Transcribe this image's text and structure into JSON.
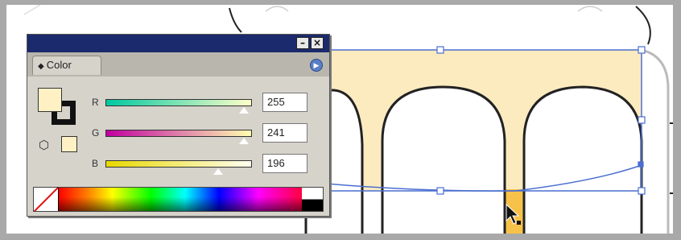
{
  "panel": {
    "tab_label": "Color",
    "titlebar_buttons": {
      "minimize_glyph": "–",
      "close_glyph": "×"
    },
    "menu_icon": "panel-menu-arrow-icon",
    "fill_color": "#FFF1C4",
    "stroke_color": "#000000",
    "sliders": [
      {
        "key": "r",
        "label": "R",
        "value": "255",
        "gradient_from": "#00c8a0",
        "gradient_to": "#ffffc8",
        "level": 1.0
      },
      {
        "key": "g",
        "label": "G",
        "value": "241",
        "gradient_from": "#c000a0",
        "gradient_to": "#ffffb0",
        "level": 0.945
      },
      {
        "key": "b",
        "label": "B",
        "value": "196",
        "gradient_from": "#e8d800",
        "gradient_to": "#fffff0",
        "level": 0.769
      }
    ],
    "icons": {
      "diamond": "tab-diamond-icon",
      "cube": "3d-cube-icon",
      "none_swatch": "none-color-swatch-icon"
    }
  },
  "canvas": {
    "fill_color": "#FDEBC0",
    "accent_color": "#F7C24A",
    "selection_color": "#4A6FD0"
  }
}
